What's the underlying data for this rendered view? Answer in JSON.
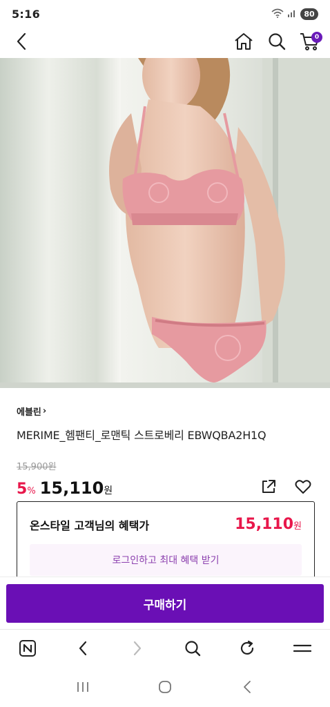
{
  "status_bar": {
    "time": "5:16",
    "battery": "80"
  },
  "top_nav": {
    "cart_count": "0"
  },
  "product": {
    "brand": "에블린",
    "brand_chevron": "›",
    "name": "MERIME_헴팬티_로맨틱 스트로베리 EBWQBA2H1Q",
    "original_price": "15,900원",
    "discount_number": "5",
    "discount_unit": "%",
    "sale_price_number": "15,110",
    "sale_price_unit": "원"
  },
  "benefit": {
    "title": "온스타일 고객님의 혜택가",
    "price_number": "15,110",
    "price_unit": "원",
    "login_label": "로그인하고 최대 혜택 받기"
  },
  "buy_button": {
    "label": "구매하기"
  },
  "colors": {
    "accent": "#6a0fb5",
    "sale": "#e8174b",
    "badge": "#6a1bb9"
  },
  "icons": [
    "back-icon",
    "home-icon",
    "search-icon",
    "cart-icon",
    "share-icon",
    "heart-icon",
    "naver-home-icon",
    "browser-back-icon",
    "browser-forward-icon",
    "browser-search-icon",
    "refresh-icon",
    "menu-icon",
    "recent-apps-icon",
    "home-circle-icon",
    "system-back-icon"
  ]
}
